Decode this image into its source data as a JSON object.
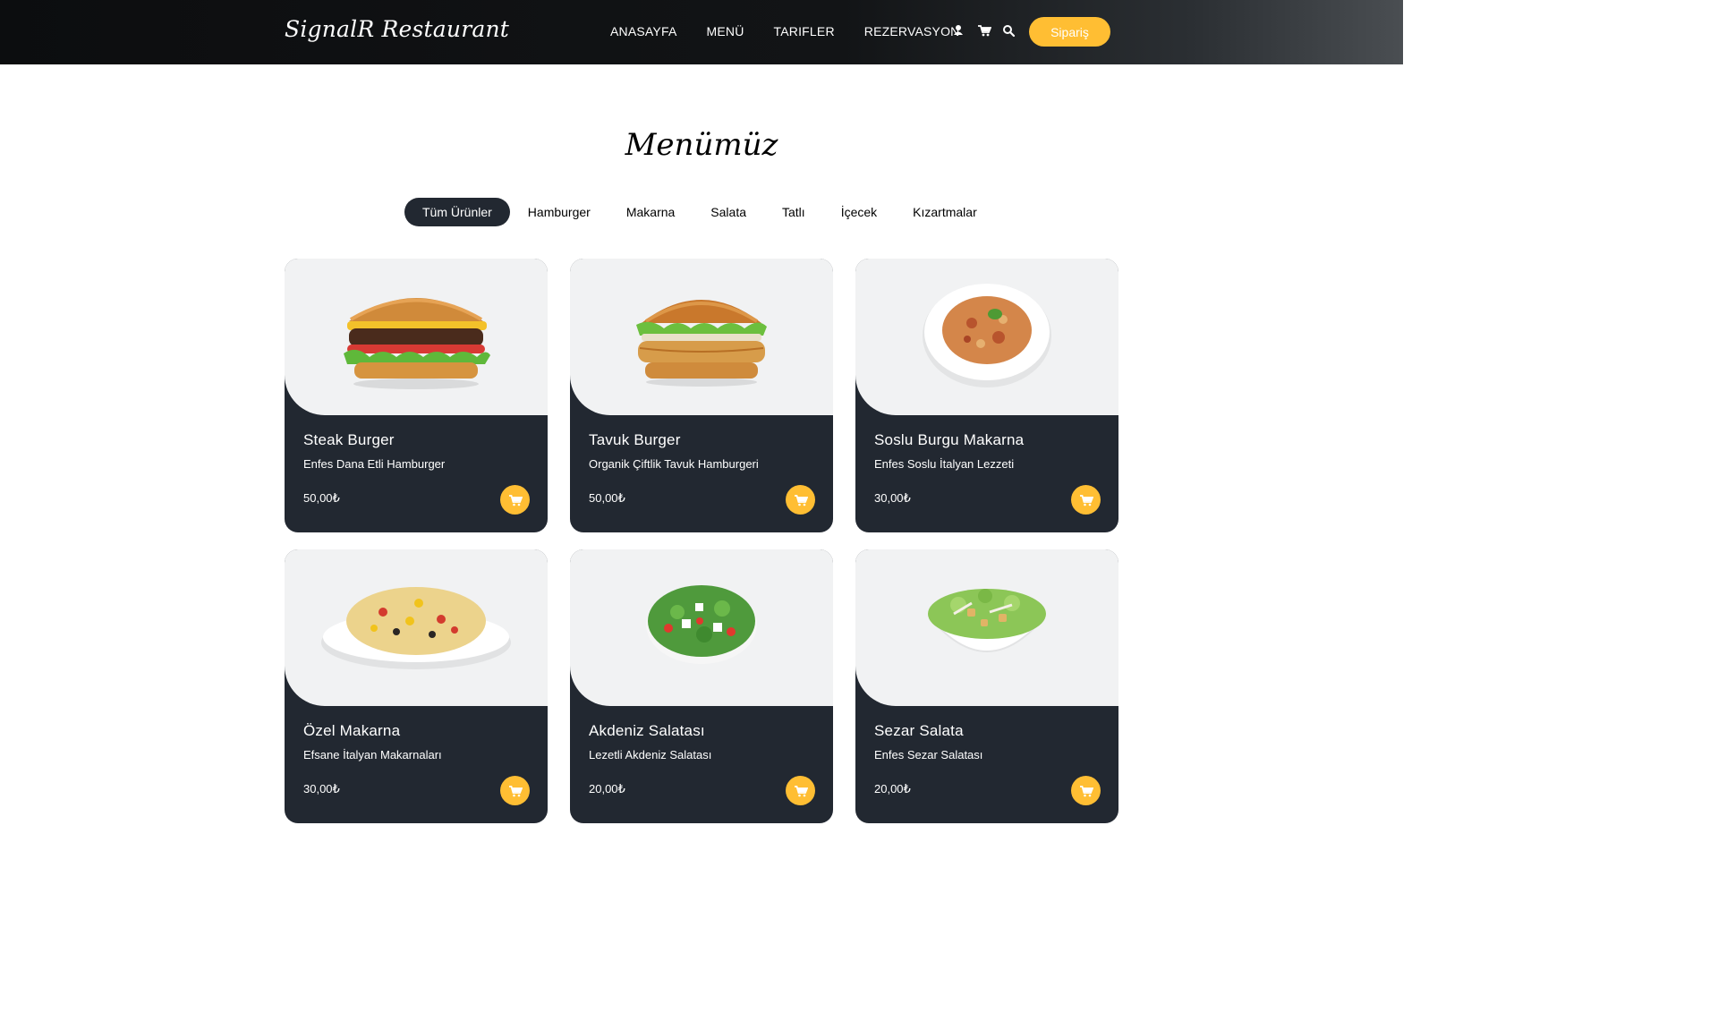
{
  "header": {
    "brand": "SignalR Restaurant",
    "nav": [
      "ANASAYFA",
      "MENÜ",
      "TARIFLER",
      "REZERVASYON"
    ],
    "order_button": "Sipariş",
    "icons": [
      "user-icon",
      "cart-icon",
      "search-icon"
    ]
  },
  "section": {
    "title": "Menümüz"
  },
  "filters": {
    "items": [
      "Tüm Ürünler",
      "Hamburger",
      "Makarna",
      "Salata",
      "Tatlı",
      "İçecek",
      "Kızartmalar"
    ],
    "active": "Tüm Ürünler"
  },
  "products": [
    {
      "name": "Steak Burger",
      "desc": "Enfes Dana Etli Hamburger",
      "price": "50,00₺",
      "image": "burger"
    },
    {
      "name": "Tavuk Burger",
      "desc": "Organik Çiftlik Tavuk Hamburgeri",
      "price": "50,00₺",
      "image": "chicken-burger"
    },
    {
      "name": "Soslu Burgu Makarna",
      "desc": "Enfes Soslu İtalyan Lezzeti",
      "price": "30,00₺",
      "image": "pasta-plate"
    },
    {
      "name": "Özel Makarna",
      "desc": "Efsane İtalyan Makarnaları",
      "price": "30,00₺",
      "image": "macaroni"
    },
    {
      "name": "Akdeniz Salatası",
      "desc": "Lezetli Akdeniz Salatası",
      "price": "20,00₺",
      "image": "greek-salad"
    },
    {
      "name": "Sezar Salata",
      "desc": "Enfes Sezar Salatası",
      "price": "20,00₺",
      "image": "caesar-salad"
    }
  ],
  "colors": {
    "accent": "#ffbe33",
    "dark": "#222831",
    "image_bg": "#f1f2f3"
  }
}
